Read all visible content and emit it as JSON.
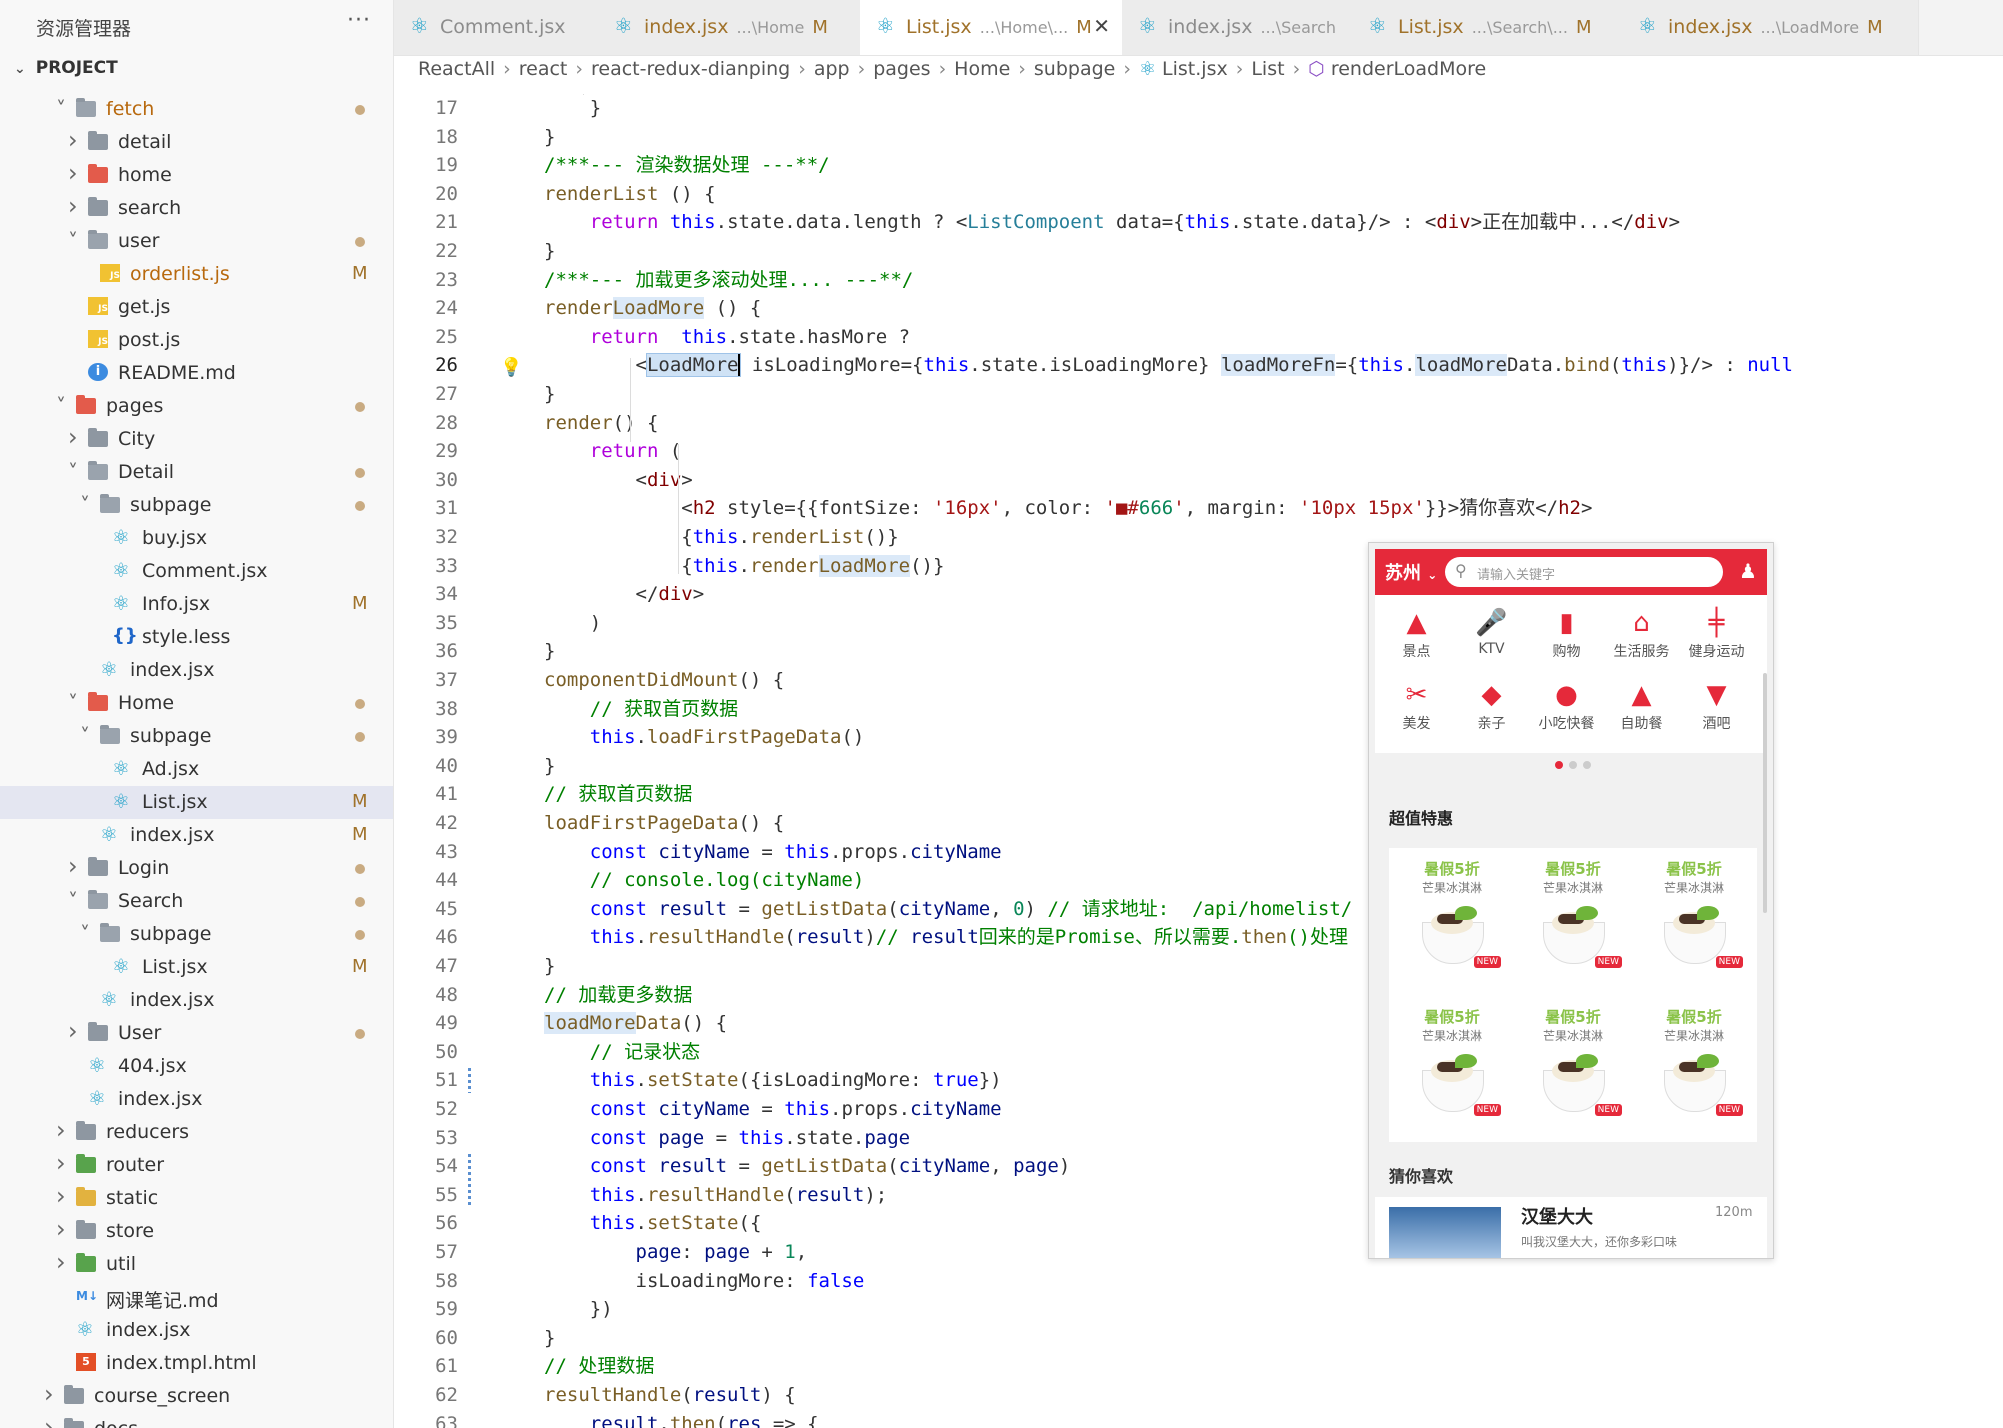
{
  "explorer": {
    "title": "资源管理器",
    "more": "···",
    "project": "PROJECT",
    "tree": [
      {
        "label": "fetch",
        "depth": 7,
        "type": "folder",
        "open": true,
        "chev": "down",
        "color": "open",
        "dot": true,
        "orange": true
      },
      {
        "label": "detail",
        "depth": 8,
        "type": "folder",
        "chev": "right"
      },
      {
        "label": "home",
        "depth": 8,
        "type": "folder",
        "chev": "right",
        "color": "red"
      },
      {
        "label": "search",
        "depth": 8,
        "type": "folder",
        "chev": "right"
      },
      {
        "label": "user",
        "depth": 8,
        "type": "folder",
        "open": true,
        "chev": "down",
        "color": "open",
        "dot": true
      },
      {
        "label": "orderlist.js",
        "depth": 9,
        "type": "js",
        "badge": "M",
        "orange": true
      },
      {
        "label": "get.js",
        "depth": 8,
        "type": "js"
      },
      {
        "label": "post.js",
        "depth": 8,
        "type": "js"
      },
      {
        "label": "README.md",
        "depth": 8,
        "type": "info"
      },
      {
        "label": "pages",
        "depth": 7,
        "type": "folder",
        "open": true,
        "chev": "down",
        "color": "red",
        "dot": true
      },
      {
        "label": "City",
        "depth": 8,
        "type": "folder",
        "chev": "right"
      },
      {
        "label": "Detail",
        "depth": 8,
        "type": "folder",
        "open": true,
        "chev": "down",
        "color": "open",
        "dot": true
      },
      {
        "label": "subpage",
        "depth": 9,
        "type": "folder",
        "open": true,
        "chev": "down",
        "color": "open",
        "dot": true
      },
      {
        "label": "buy.jsx",
        "depth": 10,
        "type": "react"
      },
      {
        "label": "Comment.jsx",
        "depth": 10,
        "type": "react"
      },
      {
        "label": "Info.jsx",
        "depth": 10,
        "type": "react",
        "badge": "M"
      },
      {
        "label": "style.less",
        "depth": 10,
        "type": "braces"
      },
      {
        "label": "index.jsx",
        "depth": 9,
        "type": "react"
      },
      {
        "label": "Home",
        "depth": 8,
        "type": "folder",
        "open": true,
        "chev": "down",
        "color": "red",
        "dot": true
      },
      {
        "label": "subpage",
        "depth": 9,
        "type": "folder",
        "open": true,
        "chev": "down",
        "color": "open",
        "dot": true
      },
      {
        "label": "Ad.jsx",
        "depth": 10,
        "type": "react"
      },
      {
        "label": "List.jsx",
        "depth": 10,
        "type": "react",
        "badge": "M",
        "selected": true
      },
      {
        "label": "index.jsx",
        "depth": 9,
        "type": "react",
        "badge": "M"
      },
      {
        "label": "Login",
        "depth": 8,
        "type": "folder",
        "chev": "right",
        "dot": true
      },
      {
        "label": "Search",
        "depth": 8,
        "type": "folder",
        "open": true,
        "chev": "down",
        "color": "open",
        "dot": true
      },
      {
        "label": "subpage",
        "depth": 9,
        "type": "folder",
        "open": true,
        "chev": "down",
        "color": "open",
        "dot": true
      },
      {
        "label": "List.jsx",
        "depth": 10,
        "type": "react",
        "badge": "M"
      },
      {
        "label": "index.jsx",
        "depth": 9,
        "type": "react"
      },
      {
        "label": "User",
        "depth": 8,
        "type": "folder",
        "chev": "right",
        "dot": true
      },
      {
        "label": "404.jsx",
        "depth": 8,
        "type": "react"
      },
      {
        "label": "index.jsx",
        "depth": 8,
        "type": "react"
      },
      {
        "label": "reducers",
        "depth": 7,
        "type": "folder",
        "chev": "right"
      },
      {
        "label": "router",
        "depth": 7,
        "type": "folder",
        "chev": "right",
        "color": "green"
      },
      {
        "label": "static",
        "depth": 7,
        "type": "folder",
        "chev": "right",
        "color": "yellow"
      },
      {
        "label": "store",
        "depth": 7,
        "type": "folder",
        "chev": "right"
      },
      {
        "label": "util",
        "depth": 7,
        "type": "folder",
        "chev": "right",
        "color": "green"
      },
      {
        "label": "网课笔记.md",
        "depth": 7,
        "type": "md"
      },
      {
        "label": "index.jsx",
        "depth": 7,
        "type": "react"
      },
      {
        "label": "index.tmpl.html",
        "depth": 7,
        "type": "html"
      },
      {
        "label": "course_screen",
        "depth": 6,
        "type": "folder",
        "chev": "right"
      },
      {
        "label": "docs",
        "depth": 6,
        "type": "folder",
        "chev": "right"
      }
    ]
  },
  "tabs": [
    {
      "name": "Comment.jsx",
      "path": "",
      "badge": ""
    },
    {
      "name": "index.jsx",
      "path": "...\\Home",
      "badge": "M"
    },
    {
      "name": "List.jsx",
      "path": "...\\Home\\...",
      "badge": "M",
      "active": true
    },
    {
      "name": "index.jsx",
      "path": "...\\Search",
      "badge": ""
    },
    {
      "name": "List.jsx",
      "path": "...\\Search\\...",
      "badge": "M"
    },
    {
      "name": "index.jsx",
      "path": "...\\LoadMore",
      "badge": "M"
    }
  ],
  "breadcrumb": [
    "ReactAll",
    "react",
    "react-redux-dianping",
    "app",
    "pages",
    "Home",
    "subpage",
    "List.jsx",
    "List",
    "renderLoadMore"
  ],
  "editor": {
    "first_line": 17,
    "current_line": 26,
    "lines": [
      "    }",
      "}",
      "/***--- 渲染数据处理 ---**/",
      "renderList () {",
      "    return this.state.data.length ? <ListCompoent data={this.state.data}/> : <div>正在加载中...</div>",
      "}",
      "/***--- 加载更多滚动处理.... ---**/",
      "renderLoadMore () {",
      "    return  this.state.hasMore ?",
      "        <LoadMore isLoadingMore={this.state.isLoadingMore} loadMoreFn={this.loadMoreData.bind(this)}/> : null",
      "}",
      "render() {",
      "    return (",
      "        <div>",
      "            <h2 style={{fontSize: '16px', color: '■#666', margin: '10px 15px'}}>猜你喜欢</h2>",
      "            {this.renderList()}",
      "            {this.renderLoadMore()}",
      "        </div>",
      "    )",
      "}",
      "componentDidMount() {",
      "    // 获取首页数据",
      "    this.loadFirstPageData()",
      "}",
      "// 获取首页数据",
      "loadFirstPageData() {",
      "    const cityName = this.props.cityName",
      "    // console.log(cityName)",
      "    const result = getListData(cityName, 0) // 请求地址:  /api/homelist/",
      "    this.resultHandle(result)// result回来的是Promise、所以需要.then()处理",
      "}",
      "// 加载更多数据",
      "loadMoreData() {",
      "    // 记录状态",
      "    this.setState({isLoadingMore: true})",
      "    const cityName = this.props.cityName",
      "    const page = this.state.page",
      "    const result = getListData(cityName, page)",
      "    this.resultHandle(result);",
      "    this.setState({",
      "        page: page + 1,",
      "        isLoadingMore: false",
      "    })",
      "}",
      "// 处理数据",
      "resultHandle(result) {",
      "    result.then(res => {"
    ]
  },
  "phone": {
    "city": "苏州",
    "search_placeholder": "请输入关键字",
    "categories": [
      {
        "label": "景点",
        "icon": "▲"
      },
      {
        "label": "KTV",
        "icon": "🎤"
      },
      {
        "label": "购物",
        "icon": "▮"
      },
      {
        "label": "生活服务",
        "icon": "⌂"
      },
      {
        "label": "健身运动",
        "icon": "╪"
      },
      {
        "label": "美发",
        "icon": "✂"
      },
      {
        "label": "亲子",
        "icon": "◆"
      },
      {
        "label": "小吃快餐",
        "icon": "●"
      },
      {
        "label": "自助餐",
        "icon": "▲"
      },
      {
        "label": "酒吧",
        "icon": "▼"
      }
    ],
    "section_deals": "超值特惠",
    "deals": [
      {
        "title": "暑假5折",
        "sub": "芒果冰淇淋"
      },
      {
        "title": "暑假5折",
        "sub": "芒果冰淇淋"
      },
      {
        "title": "暑假5折",
        "sub": "芒果冰淇淋"
      },
      {
        "title": "暑假5折",
        "sub": "芒果冰淇淋"
      },
      {
        "title": "暑假5折",
        "sub": "芒果冰淇淋"
      },
      {
        "title": "暑假5折",
        "sub": "芒果冰淇淋"
      }
    ],
    "new_badge": "NEW",
    "section_like": "猜你喜欢",
    "item": {
      "name": "汉堡大大",
      "distance": "120m",
      "desc": "叫我汉堡大大，还你多彩口味"
    }
  }
}
